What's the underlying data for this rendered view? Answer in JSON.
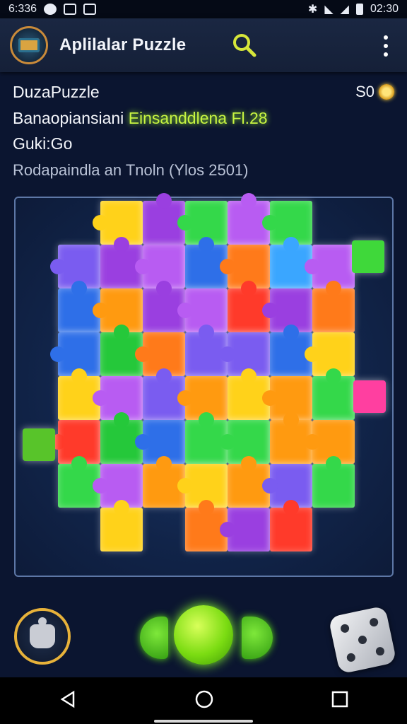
{
  "status_bar": {
    "time_left": "6:336",
    "time_right": "02:30"
  },
  "app_bar": {
    "title": "Aplilalar Puzzle",
    "icons": [
      "app-logo",
      "search-icon",
      "more-vert-icon"
    ]
  },
  "info": {
    "game_name": "DuzaPuzzle",
    "score": "S0",
    "line2_prefix": "Banaopiansiani",
    "line2_highlight": "Einsanddlena Fl.28",
    "line3": "Guki:Go",
    "line4": "Rodapaindla an Tnoln (Ylos 2501)"
  },
  "colors": {
    "background": "#0b1530",
    "accent_green": "#7bdc12",
    "accent_gold": "#e7b23a",
    "board_border": "#5d77a6"
  },
  "controls": {
    "icons": [
      "hint-icon",
      "left-half-button",
      "go-button",
      "right-half-button",
      "dice-icon"
    ]
  },
  "nav_bar": {
    "icons": [
      "back-icon",
      "home-icon",
      "recents-icon"
    ]
  }
}
